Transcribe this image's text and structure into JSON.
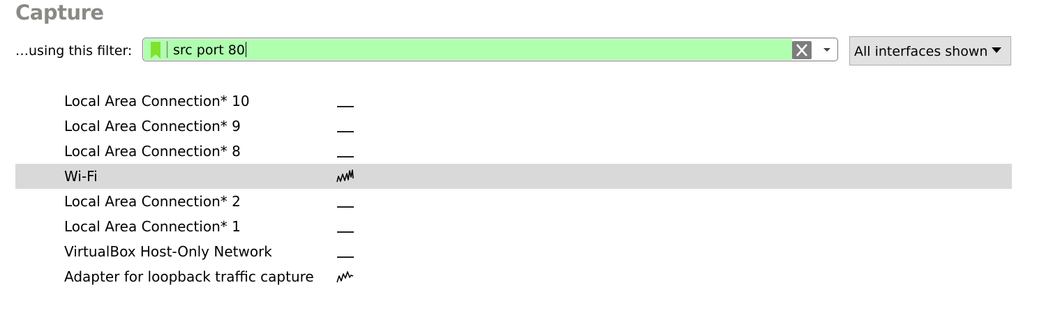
{
  "section": {
    "title": "Capture"
  },
  "filter": {
    "label": "…using this filter:",
    "value": "src port 80",
    "valid_color": "#afffaf",
    "bookmark_icon": "bookmark-icon",
    "clear_icon": "close-icon",
    "dropdown_icon": "chevron-down-icon"
  },
  "interfaces_selector": {
    "label": "All interfaces shown",
    "icon": "caret-down-icon"
  },
  "interfaces": [
    {
      "name": "Local Area Connection* 10",
      "activity": "flat",
      "selected": false
    },
    {
      "name": "Local Area Connection* 9",
      "activity": "flat",
      "selected": false
    },
    {
      "name": "Local Area Connection* 8",
      "activity": "flat",
      "selected": false
    },
    {
      "name": "Wi-Fi",
      "activity": "active",
      "selected": true
    },
    {
      "name": "Local Area Connection* 2",
      "activity": "flat",
      "selected": false
    },
    {
      "name": "Local Area Connection* 1",
      "activity": "flat",
      "selected": false
    },
    {
      "name": "VirtualBox Host-Only Network",
      "activity": "flat",
      "selected": false
    },
    {
      "name": "Adapter for loopback traffic capture",
      "activity": "low",
      "selected": false
    }
  ],
  "colors": {
    "selected_row": "#d9d9d9",
    "title": "#8a8a85",
    "bookmark": "#7fe22e"
  }
}
